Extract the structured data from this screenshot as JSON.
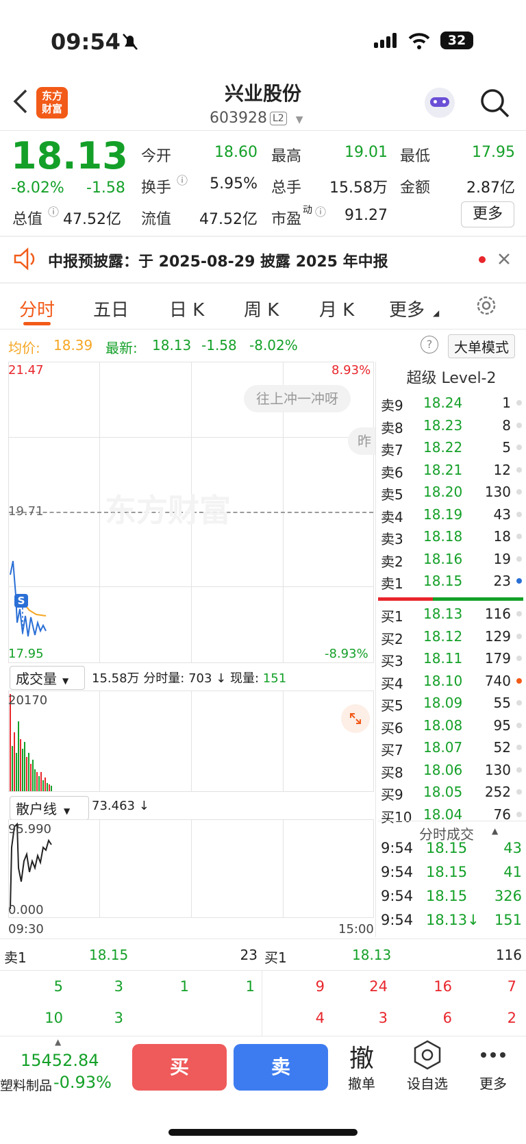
{
  "status_bar": {
    "time": "09:54",
    "battery": "32"
  },
  "header": {
    "back_icon": "chevron-left-icon",
    "logo_text": "东方\n财富",
    "title": "兴业股份",
    "code": "603928",
    "level_badge": "L2"
  },
  "quote": {
    "price": "18.13",
    "change_pct": "-8.02%",
    "change": "-1.58",
    "fields": [
      {
        "label": "今开",
        "value": "18.60",
        "color": "green"
      },
      {
        "label": "最高",
        "value": "19.01",
        "color": "green"
      },
      {
        "label": "最低",
        "value": "17.95",
        "color": "green"
      },
      {
        "label": "换手",
        "value": "5.95%",
        "color": "black"
      },
      {
        "label": "总手",
        "value": "15.58万",
        "color": "black"
      },
      {
        "label": "金额",
        "value": "2.87亿",
        "color": "black"
      },
      {
        "label": "总值",
        "value": "47.52亿",
        "color": "black"
      },
      {
        "label": "流值",
        "value": "47.52亿",
        "color": "black"
      },
      {
        "label": "市盈",
        "value": "91.27",
        "color": "black"
      }
    ],
    "pe_sup": "动",
    "more_button": "更多"
  },
  "notice": {
    "text": "中报预披露：于 2025-08-29 披露 2025 年中报"
  },
  "tabs": [
    "分时",
    "五日",
    "日 K",
    "周 K",
    "月 K",
    "更多"
  ],
  "info_line": {
    "avg_label": "均价:",
    "avg_value": "18.39",
    "latest_label": "最新:",
    "latest_value": "18.13",
    "latest_change": "-1.58",
    "latest_pct": "-8.02%",
    "mode_button": "大单模式"
  },
  "chart": {
    "top_price": "21.47",
    "top_pct": "8.93%",
    "mid_price": "19.71",
    "bottom_price": "17.95",
    "bottom_pct": "-8.93%",
    "bubble": "往上冲一冲呀",
    "bubble2": "昨",
    "watermark": "东方财富",
    "s_badge": "S",
    "volume_selector": "成交量",
    "volume_info_total": "15.58万",
    "volume_info_label": "分时量:",
    "volume_info_value": "703 ↓",
    "volume_now_label": "现量:",
    "volume_now_value": "151",
    "volume_max": "20170",
    "retail_selector": "散户线",
    "retail_value": "73.463 ↓",
    "retail_max": "95.990",
    "retail_min": "0.000",
    "time_start": "09:30",
    "time_end": "15:00"
  },
  "orderbook": {
    "title": "超级 Level-2",
    "asks": [
      {
        "label": "卖9",
        "price": "18.24",
        "vol": "1"
      },
      {
        "label": "卖8",
        "price": "18.23",
        "vol": "8"
      },
      {
        "label": "卖7",
        "price": "18.22",
        "vol": "5"
      },
      {
        "label": "卖6",
        "price": "18.21",
        "vol": "12"
      },
      {
        "label": "卖5",
        "price": "18.20",
        "vol": "130"
      },
      {
        "label": "卖4",
        "price": "18.19",
        "vol": "43"
      },
      {
        "label": "卖3",
        "price": "18.18",
        "vol": "18"
      },
      {
        "label": "卖2",
        "price": "18.16",
        "vol": "19"
      },
      {
        "label": "卖1",
        "price": "18.15",
        "vol": "23"
      }
    ],
    "bids": [
      {
        "label": "买1",
        "price": "18.13",
        "vol": "116"
      },
      {
        "label": "买2",
        "price": "18.12",
        "vol": "129"
      },
      {
        "label": "买3",
        "price": "18.11",
        "vol": "179"
      },
      {
        "label": "买4",
        "price": "18.10",
        "vol": "740"
      },
      {
        "label": "买5",
        "price": "18.09",
        "vol": "55"
      },
      {
        "label": "买6",
        "price": "18.08",
        "vol": "95"
      },
      {
        "label": "买7",
        "price": "18.07",
        "vol": "52"
      },
      {
        "label": "买8",
        "price": "18.06",
        "vol": "130"
      },
      {
        "label": "买9",
        "price": "18.05",
        "vol": "252"
      },
      {
        "label": "买10",
        "price": "18.04",
        "vol": "76"
      }
    ],
    "trades_title": "分时成交",
    "trades": [
      {
        "time": "9:54",
        "price": "18.15",
        "vol": "43"
      },
      {
        "time": "9:54",
        "price": "18.15",
        "vol": "41"
      },
      {
        "time": "9:54",
        "price": "18.15",
        "vol": "326"
      },
      {
        "time": "9:54",
        "price": "18.13↓",
        "vol": "151"
      }
    ]
  },
  "queue": {
    "sell_label": "卖1",
    "sell_price": "18.15",
    "sell_vol": "23",
    "buy_label": "买1",
    "buy_price": "18.13",
    "buy_vol": "116",
    "sell_row1": [
      "5",
      "3",
      "1",
      "1"
    ],
    "sell_row2": [
      "10",
      "3"
    ],
    "buy_row1": [
      "9",
      "24",
      "16",
      "7"
    ],
    "buy_row2": [
      "4",
      "3",
      "6",
      "2"
    ]
  },
  "bottom": {
    "index_value": "15452.84",
    "index_name": "塑料制品",
    "index_pct": "-0.93%",
    "buy": "买",
    "sell": "卖",
    "cancel_icon": "撤",
    "cancel_label": "撤单",
    "watch_label": "设自选",
    "more_label": "更多"
  }
}
